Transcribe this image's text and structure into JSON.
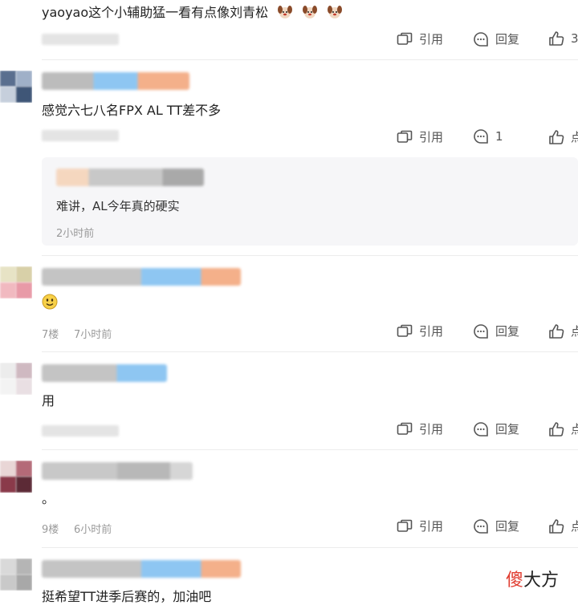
{
  "actions": {
    "quote": "引用",
    "reply": "回复"
  },
  "comments": [
    {
      "text": "yaoyao这个小辅助猛一看有点像刘青松",
      "likes": "3"
    },
    {
      "text": "感觉六七八名FPX AL TT差不多",
      "reply_count": "1",
      "like_label": "点"
    },
    {
      "text": "",
      "floor": "7楼",
      "time": "7小时前",
      "like_label": "点"
    },
    {
      "text": "用",
      "like_label": "点"
    },
    {
      "text": "。",
      "floor": "9楼",
      "time": "6小时前",
      "like_label": "点"
    },
    {
      "text": "挺希望TT进季后赛的，加油吧"
    }
  ],
  "reply": {
    "text": "难讲，AL今年真的硬实",
    "time": "2小时前"
  },
  "watermark": {
    "char1": "傻",
    "rest": "大方"
  },
  "colors": {
    "accent_blue": "#8ec6f2",
    "accent_orange": "#f4b08a",
    "text": "#222222",
    "muted": "#9a9a9a"
  },
  "icons": [
    "quote-icon",
    "reply-icon",
    "like-icon",
    "dog-emoji",
    "smile-emoji"
  ]
}
